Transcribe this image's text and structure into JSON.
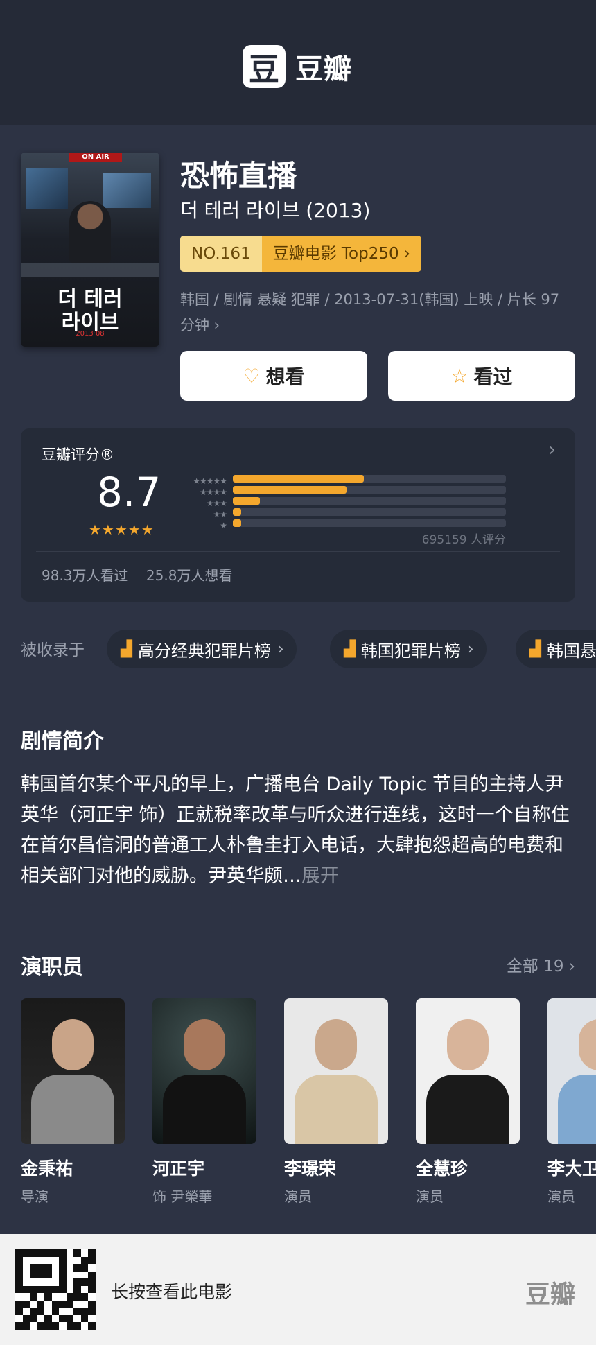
{
  "header": {
    "logo_mark": "豆",
    "logo_text": "豆瓣"
  },
  "movie": {
    "title": "恐怖直播",
    "original_title": "더 테러 라이브 (2013)",
    "rank_no": "NO.161",
    "rank_list": "豆瓣电影 Top250 ›",
    "meta": "韩国 / 剧情 悬疑 犯罪 / 2013-07-31(韩国) 上映 / 片长 97 分钟 ›",
    "poster": {
      "badge": "ON AIR",
      "title_line1": "더 테러",
      "title_line2": "라이브",
      "date": "2013·08"
    },
    "want_label": "想看",
    "seen_label": "看过"
  },
  "rating": {
    "title": "豆瓣评分®",
    "score": "8.7",
    "stars_display": "★★★★★",
    "star_rows": [
      "★★★★★",
      "★★★★",
      "★★★",
      "★★",
      "★"
    ],
    "distribution": [
      0.48,
      0.415,
      0.1,
      0.03,
      0.03
    ],
    "count": "695159 人评分",
    "seen_count": "98.3万人看过",
    "want_count": "25.8万人想看"
  },
  "collections": {
    "label": "被收录于",
    "items": [
      "高分经典犯罪片榜",
      "韩国犯罪片榜",
      "韩国悬"
    ]
  },
  "synopsis": {
    "title": "剧情简介",
    "text": "韩国首尔某个平凡的早上，广播电台 Daily Topic 节目的主持人尹英华（河正宇 饰）正就税率改革与听众进行连线，这时一个自称住在首尔昌信洞的普通工人朴鲁圭打入电话，大肆抱怨超高的电费和相关部门对他的威胁。尹英华颇…",
    "more": "展开"
  },
  "cast": {
    "title": "演职员",
    "all_label": "全部 19 ›",
    "members": [
      {
        "name": "金秉祐",
        "role": "导演"
      },
      {
        "name": "河正宇",
        "role": "饰 尹榮華"
      },
      {
        "name": "李璟荣",
        "role": "演员"
      },
      {
        "name": "全慧珍",
        "role": "演员"
      },
      {
        "name": "李大卫",
        "role": "演员"
      }
    ]
  },
  "footer": {
    "text": "长按查看此电影",
    "logo": "豆瓣"
  },
  "colors": {
    "background": "#2d3344",
    "header": "#252a37",
    "accent": "#f4a72d",
    "card": "#252b38"
  }
}
